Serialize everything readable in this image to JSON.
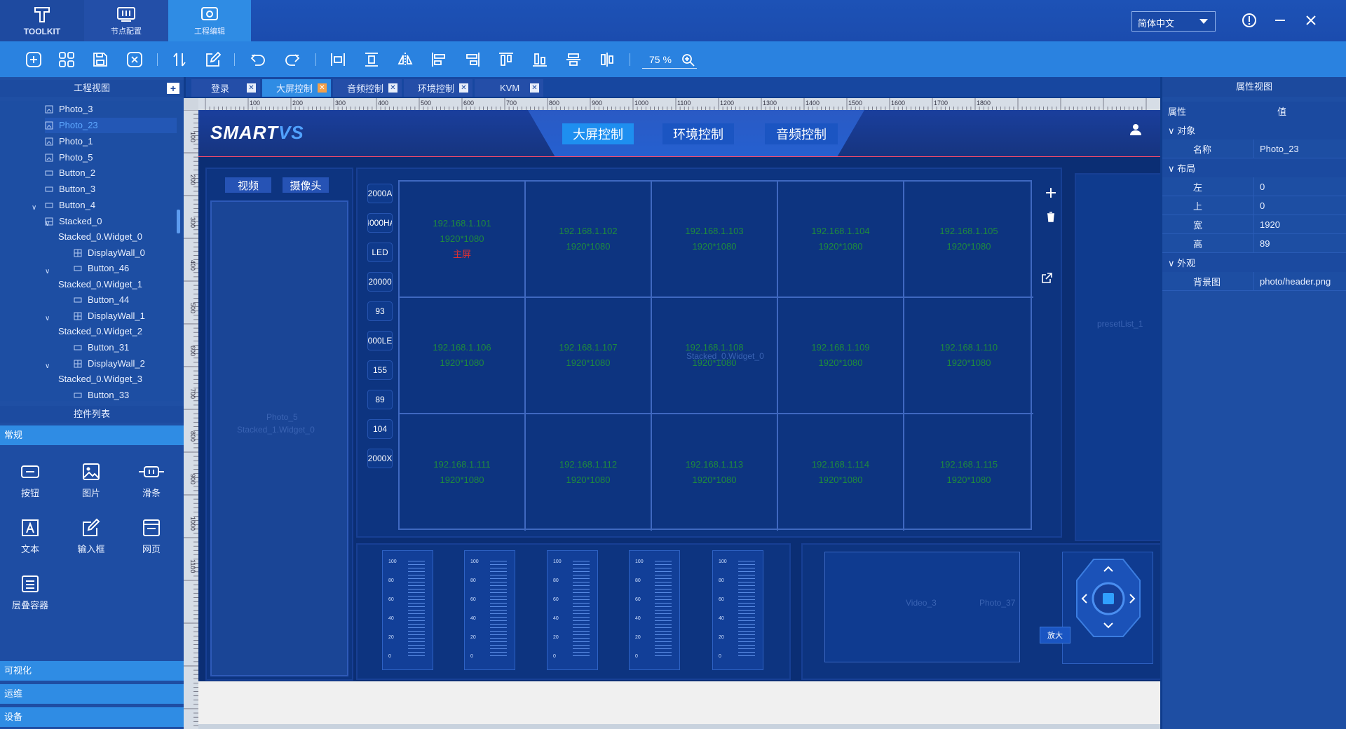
{
  "titlebar": {
    "tabs": [
      {
        "label": "TOOLKIT",
        "icon": "toolkit-logo-icon"
      },
      {
        "label": "节点配置",
        "icon": "node-config-icon"
      },
      {
        "label": "工程编辑",
        "icon": "project-edit-icon"
      }
    ],
    "language": "简体中文",
    "window_buttons": [
      "info-icon",
      "minimize-icon",
      "close-icon"
    ],
    "colors": {
      "active_tab": "#2f8ce4",
      "background": "#1d52b6"
    }
  },
  "toolbar": {
    "icons": [
      "add-icon",
      "grid-icon",
      "save-icon",
      "close-doc-icon",
      "sort-icon",
      "edit-icon",
      "undo-icon",
      "redo-icon",
      "align-h-center-icon",
      "align-v-center-icon",
      "flip-icon",
      "align-left-icon",
      "align-right-icon",
      "align-top-icon",
      "align-bottom-icon",
      "distribute-v-icon",
      "distribute-h-icon",
      "zoom-in-icon"
    ],
    "zoom": "75 %"
  },
  "project_view": {
    "title": "工程视图",
    "tree": [
      {
        "label": "Photo_3"
      },
      {
        "label": "Photo_23"
      },
      {
        "label": "Photo_1"
      },
      {
        "label": "Photo_5"
      },
      {
        "label": "Button_2"
      },
      {
        "label": "Button_3"
      },
      {
        "label": "Button_4"
      },
      {
        "label": "Stacked_0"
      },
      {
        "label": "Stacked_0.Widget_0"
      },
      {
        "label": "DisplayWall_0"
      },
      {
        "label": "Button_46"
      },
      {
        "label": "Stacked_0.Widget_1"
      },
      {
        "label": "Button_44"
      },
      {
        "label": "DisplayWall_1"
      },
      {
        "label": "Stacked_0.Widget_2"
      },
      {
        "label": "Button_31"
      },
      {
        "label": "DisplayWall_2"
      },
      {
        "label": "Stacked_0.Widget_3"
      },
      {
        "label": "Button_33"
      }
    ]
  },
  "widget_list": {
    "title": "控件列表",
    "categories": {
      "normal": "常规",
      "visual": "可视化",
      "ops": "运维",
      "device": "设备"
    },
    "items": [
      {
        "label": "按钮",
        "icon": "button-widget-icon"
      },
      {
        "label": "图片",
        "icon": "image-widget-icon"
      },
      {
        "label": "滑条",
        "icon": "slider-widget-icon"
      },
      {
        "label": "文本",
        "icon": "text-widget-icon"
      },
      {
        "label": "输入框",
        "icon": "input-widget-icon"
      },
      {
        "label": "网页",
        "icon": "webpage-widget-icon"
      },
      {
        "label": "层叠容器",
        "icon": "stack-container-icon"
      }
    ]
  },
  "doc_tabs": [
    {
      "label": "登录"
    },
    {
      "label": "大屏控制"
    },
    {
      "label": "音频控制"
    },
    {
      "label": "环境控制"
    },
    {
      "label": "KVM"
    }
  ],
  "ruler": {
    "marks": [
      "100",
      "200",
      "300",
      "400",
      "500",
      "600",
      "700",
      "800",
      "900",
      "1000",
      "1100",
      "1200",
      "1300",
      "1400",
      "1500",
      "1600",
      "1700",
      "1800"
    ]
  },
  "design": {
    "logo_a": "SMART",
    "logo_b": "VS",
    "nav": [
      "大屏控制",
      "环境控制",
      "音频控制"
    ],
    "source_tabs": [
      "视频",
      "摄像头"
    ],
    "ghost_labels": {
      "photo5": "Photo_5",
      "stacked_widget0": "Stacked_1.Widget_0",
      "wall_widget": "Stacked_0.Widget_0",
      "preset": "presetList_1",
      "video": "Video_3",
      "photo": "Photo_37"
    },
    "side_chips": [
      "2000A",
      "4000HA",
      "LED",
      "20000",
      "93",
      "000LE",
      "155",
      "89",
      "104",
      "2000X"
    ],
    "cells": [
      {
        "ip": "192.168.1.101",
        "res": "1920*1080",
        "tag": "主屏"
      },
      {
        "ip": "192.168.1.102",
        "res": "1920*1080",
        "tag": ""
      },
      {
        "ip": "192.168.1.103",
        "res": "1920*1080",
        "tag": ""
      },
      {
        "ip": "192.168.1.104",
        "res": "1920*1080",
        "tag": ""
      },
      {
        "ip": "192.168.1.105",
        "res": "1920*1080",
        "tag": ""
      },
      {
        "ip": "192.168.1.106",
        "res": "1920*1080",
        "tag": ""
      },
      {
        "ip": "192.168.1.107",
        "res": "1920*1080",
        "tag": ""
      },
      {
        "ip": "192.168.1.108",
        "res": "1920*1080",
        "tag": ""
      },
      {
        "ip": "192.168.1.109",
        "res": "1920*1080",
        "tag": ""
      },
      {
        "ip": "192.168.1.110",
        "res": "1920*1080",
        "tag": ""
      },
      {
        "ip": "192.168.1.111",
        "res": "1920*1080",
        "tag": ""
      },
      {
        "ip": "192.168.1.112",
        "res": "1920*1080",
        "tag": ""
      },
      {
        "ip": "192.168.1.113",
        "res": "1920*1080",
        "tag": ""
      },
      {
        "ip": "192.168.1.114",
        "res": "1920*1080",
        "tag": ""
      },
      {
        "ip": "192.168.1.115",
        "res": "1920*1080",
        "tag": ""
      }
    ],
    "slider_ticks": [
      "100",
      "80",
      "60",
      "40",
      "20",
      "0"
    ],
    "zoom_btn": "放大"
  },
  "properties": {
    "title": "属性视图",
    "col_prop": "属性",
    "col_val": "值",
    "groups": {
      "object": "对象",
      "layout": "布局",
      "appearance": "外观"
    },
    "name": {
      "k": "名称",
      "v": "Photo_23"
    },
    "left": {
      "k": "左",
      "v": "0"
    },
    "top": {
      "k": "上",
      "v": "0"
    },
    "width": {
      "k": "宽",
      "v": "1920"
    },
    "height": {
      "k": "高",
      "v": "89"
    },
    "bg": {
      "k": "背景图",
      "v": "photo/header.png"
    }
  }
}
